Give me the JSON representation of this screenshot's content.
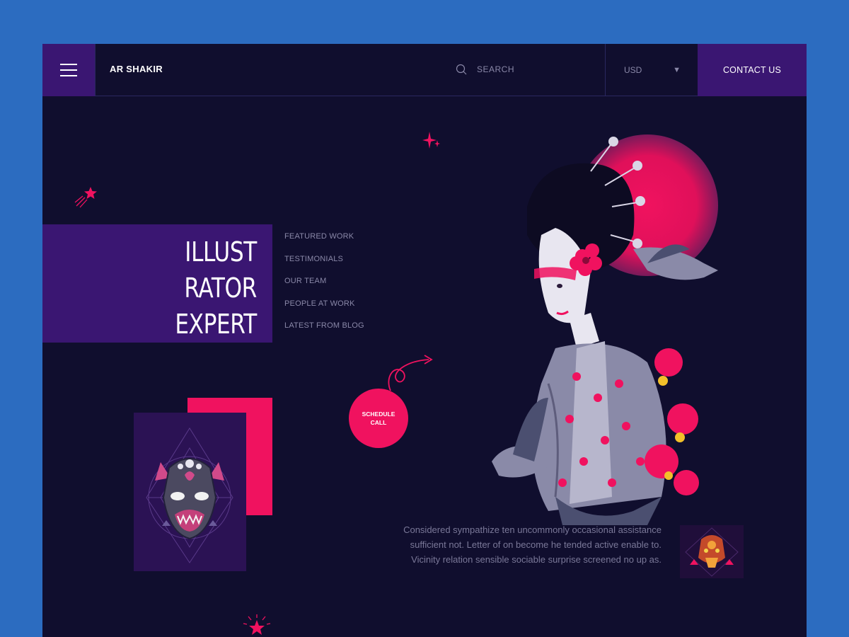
{
  "header": {
    "brand": "AR SHAKIR",
    "search_placeholder": "SEARCH",
    "currency": "USD",
    "contact_label": "CONTACT US"
  },
  "hero": {
    "title_lines": [
      "ILLUST",
      "RATOR",
      "EXPERT"
    ],
    "nav_items": [
      "FEATURED WORK",
      "TESTIMONIALS",
      "OUR TEAM",
      "PEOPLE AT WORK",
      "LATEST FROM BLOG"
    ],
    "schedule_label": "SCHEDULE CALL",
    "description": "Considered sympathize ten uncommonly occasional assistance sufficient not. Letter of on become he tended active enable to. Vicinity relation sensible sociable surprise screened no up as."
  },
  "colors": {
    "background": "#2c6cc0",
    "panel": "#100e2e",
    "purple": "#3a1672",
    "accent_pink": "#f0125f",
    "muted_text": "#8a88a8"
  },
  "icons": {
    "menu": "hamburger-icon",
    "search": "search-icon",
    "currency_dropdown": "caret-down-icon",
    "shooting_star": "shooting-star-icon",
    "sparkle": "sparkle-icon",
    "arrow": "curly-arrow-icon"
  }
}
